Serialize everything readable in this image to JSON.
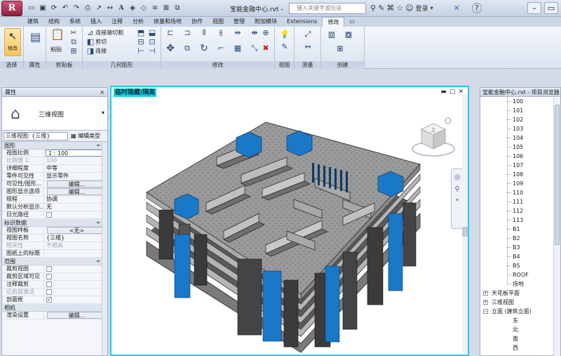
{
  "titlebar": {
    "app_glyph": "R",
    "doc_title": "宝能金融中心.rvt -",
    "search_placeholder": "键入关键字或短语",
    "login_label": "登录",
    "help_label": "?"
  },
  "tabs": [
    "建筑",
    "结构",
    "系统",
    "插入",
    "注释",
    "分析",
    "体量和场地",
    "协作",
    "视图",
    "管理",
    "附加模块",
    "Extensions",
    "修改"
  ],
  "active_tab": "修改",
  "ribbon": {
    "modify_label": "修改",
    "paste_label": "粘贴",
    "connect_end_cut": "连接端切割",
    "cut": "剪切",
    "join": "连接",
    "panels": [
      "选择",
      "属性",
      "剪贴板",
      "几何图形",
      "修改",
      "视图",
      "测量",
      "创建"
    ]
  },
  "properties": {
    "title": "属性",
    "close": "×",
    "type_name": "三维视图",
    "instance_selector": "三维视图: {三维}",
    "edit_type": "编辑类型",
    "sections": [
      {
        "name": "图形",
        "toggle": "≈",
        "rows": [
          {
            "k": "视图比例",
            "v": "1 : 100",
            "kind": "input"
          },
          {
            "k": "比例值 1:",
            "v": "100",
            "kind": "gray"
          },
          {
            "k": "详细程度",
            "v": "中等",
            "kind": "text"
          },
          {
            "k": "零件可见性",
            "v": "显示零件",
            "kind": "text"
          },
          {
            "k": "可见性/图形...",
            "v": "编辑...",
            "kind": "btn"
          },
          {
            "k": "图形显示选项",
            "v": "编辑...",
            "kind": "btn"
          },
          {
            "k": "规程",
            "v": "协调",
            "kind": "text"
          },
          {
            "k": "默认分析显示...",
            "v": "无",
            "kind": "text"
          },
          {
            "k": "日光路径",
            "v": "",
            "kind": "check"
          }
        ]
      },
      {
        "name": "标识数据",
        "toggle": "≈",
        "rows": [
          {
            "k": "视图样板",
            "v": "<无>",
            "kind": "btn"
          },
          {
            "k": "视图名称",
            "v": "{三维}",
            "kind": "text"
          },
          {
            "k": "相关性",
            "v": "不相关",
            "kind": "gray"
          },
          {
            "k": "图纸上的标题",
            "v": "",
            "kind": "text"
          }
        ]
      },
      {
        "name": "范围",
        "toggle": "≈",
        "rows": [
          {
            "k": "裁剪视图",
            "v": "",
            "kind": "check"
          },
          {
            "k": "裁剪区域可见",
            "v": "",
            "kind": "check"
          },
          {
            "k": "注释裁剪",
            "v": "",
            "kind": "check"
          },
          {
            "k": "远剪裁激活",
            "v": "",
            "kind": "check-gray"
          },
          {
            "k": "剖面框",
            "v": "✓",
            "kind": "check"
          }
        ]
      },
      {
        "name": "相机",
        "toggle": "",
        "rows": [
          {
            "k": "渲染设置",
            "v": "编辑...",
            "kind": "btn"
          }
        ]
      }
    ]
  },
  "viewport": {
    "label": "临时隐藏/隔离",
    "ctrls": [
      "▬",
      "▢",
      "✕"
    ]
  },
  "viewcube": {
    "face": "上"
  },
  "browser": {
    "title": "宝能金融中心.rvt - 项目浏览器",
    "levels": [
      "100",
      "101",
      "102",
      "103",
      "104",
      "105",
      "106",
      "107",
      "108",
      "109",
      "110",
      "111",
      "112",
      "113",
      "B1",
      "B2",
      "B3",
      "B4",
      "B5",
      "ROOF",
      "场地"
    ],
    "groups": [
      {
        "pm": "+",
        "label": "天花板平面"
      },
      {
        "pm": "+",
        "label": "三维视图"
      },
      {
        "pm": "−",
        "label": "立面 (建筑立面)"
      }
    ],
    "elevations": [
      "东",
      "北",
      "南",
      "西"
    ]
  },
  "colors": {
    "accent": "#1bd0e0",
    "blue_core": "#1a78c8",
    "concrete": "#8c8c8c"
  }
}
